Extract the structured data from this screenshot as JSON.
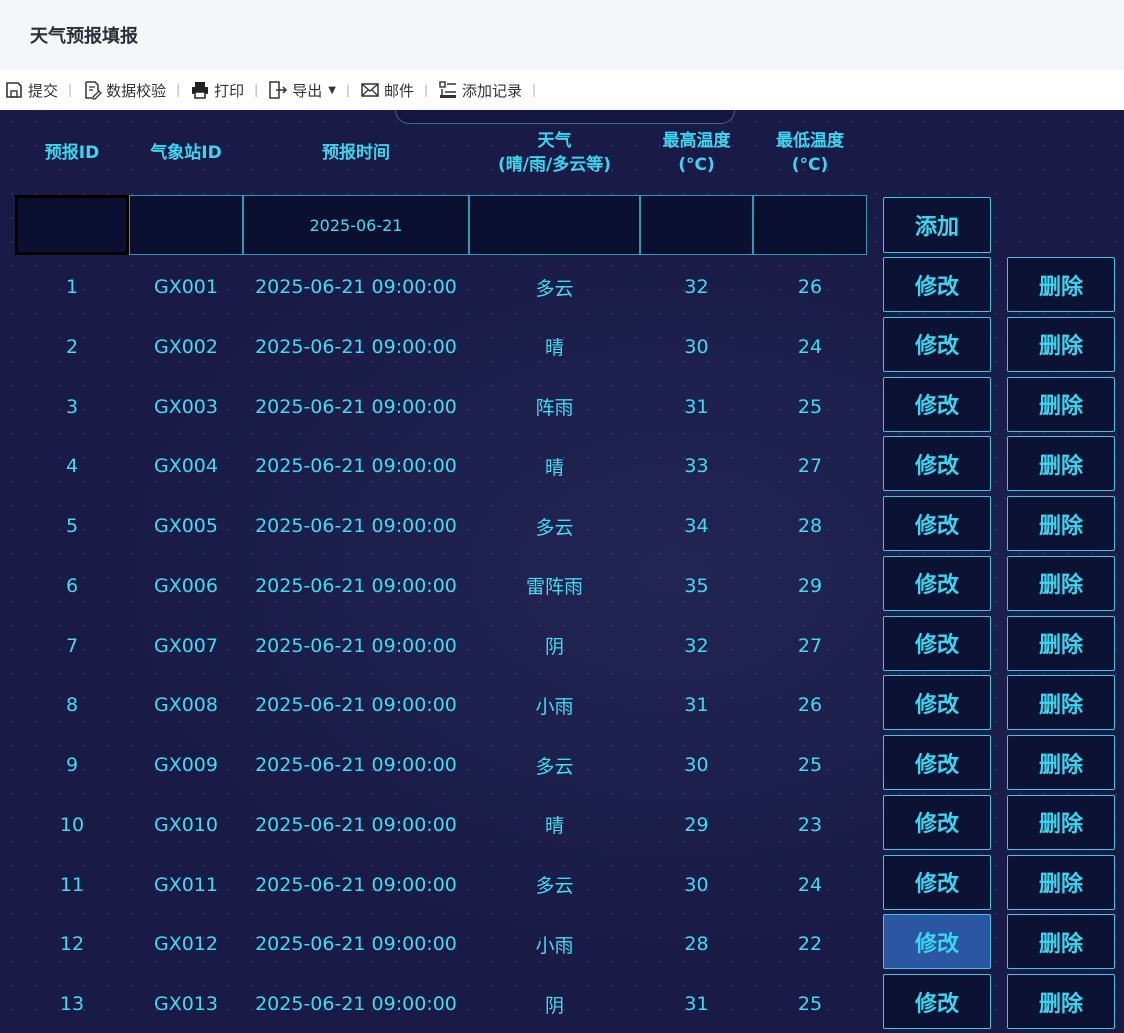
{
  "app": {
    "title": "天气预报填报"
  },
  "toolbar": {
    "submit": "提交",
    "validate": "数据校验",
    "print": "打印",
    "export": "导出",
    "mail": "邮件",
    "add_record": "添加记录"
  },
  "table": {
    "headers": {
      "forecast_id": "预报ID",
      "station_id": "气象站ID",
      "forecast_time": "预报时间",
      "weather_1": "天气",
      "weather_2": "(晴/雨/多云等)",
      "max_temp_1": "最高温度",
      "max_temp_2": "(°C)",
      "min_temp_1": "最低温度",
      "min_temp_2": "(°C)"
    },
    "new_row": {
      "forecast_time": "2025-06-21",
      "add_label": "添加"
    },
    "edit_label": "修改",
    "delete_label": "删除",
    "rows": [
      {
        "id": "1",
        "station": "GX001",
        "time": "2025-06-21 09:00:00",
        "weather": "多云",
        "max": "32",
        "min": "26"
      },
      {
        "id": "2",
        "station": "GX002",
        "time": "2025-06-21 09:00:00",
        "weather": "晴",
        "max": "30",
        "min": "24"
      },
      {
        "id": "3",
        "station": "GX003",
        "time": "2025-06-21 09:00:00",
        "weather": "阵雨",
        "max": "31",
        "min": "25"
      },
      {
        "id": "4",
        "station": "GX004",
        "time": "2025-06-21 09:00:00",
        "weather": "晴",
        "max": "33",
        "min": "27"
      },
      {
        "id": "5",
        "station": "GX005",
        "time": "2025-06-21 09:00:00",
        "weather": "多云",
        "max": "34",
        "min": "28"
      },
      {
        "id": "6",
        "station": "GX006",
        "time": "2025-06-21 09:00:00",
        "weather": "雷阵雨",
        "max": "35",
        "min": "29"
      },
      {
        "id": "7",
        "station": "GX007",
        "time": "2025-06-21 09:00:00",
        "weather": "阴",
        "max": "32",
        "min": "27"
      },
      {
        "id": "8",
        "station": "GX008",
        "time": "2025-06-21 09:00:00",
        "weather": "小雨",
        "max": "31",
        "min": "26"
      },
      {
        "id": "9",
        "station": "GX009",
        "time": "2025-06-21 09:00:00",
        "weather": "多云",
        "max": "30",
        "min": "25"
      },
      {
        "id": "10",
        "station": "GX010",
        "time": "2025-06-21 09:00:00",
        "weather": "晴",
        "max": "29",
        "min": "23"
      },
      {
        "id": "11",
        "station": "GX011",
        "time": "2025-06-21 09:00:00",
        "weather": "多云",
        "max": "30",
        "min": "24"
      },
      {
        "id": "12",
        "station": "GX012",
        "time": "2025-06-21 09:00:00",
        "weather": "小雨",
        "max": "28",
        "min": "22"
      },
      {
        "id": "13",
        "station": "GX013",
        "time": "2025-06-21 09:00:00",
        "weather": "阴",
        "max": "31",
        "min": "25"
      }
    ]
  },
  "colors": {
    "accent": "#3ad6f0",
    "board_bg": "#191a45",
    "active_button": "#2b57a2"
  }
}
